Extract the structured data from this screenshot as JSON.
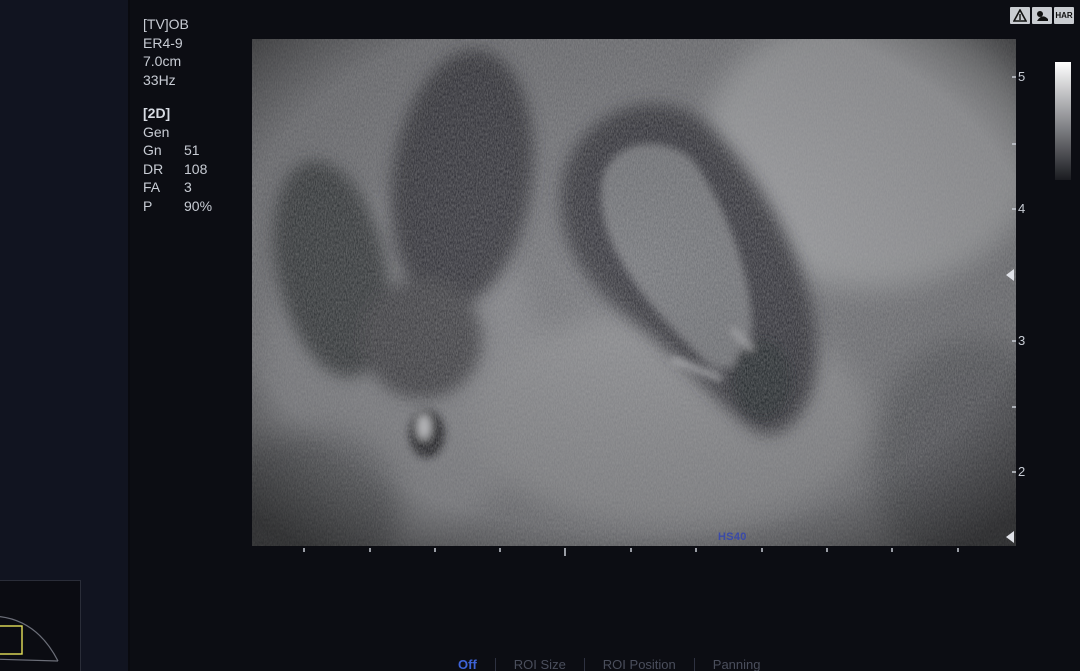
{
  "probe_info": {
    "preset": "[TV]OB",
    "probe": "ER4-9",
    "depth": "7.0cm",
    "frame_rate": "33Hz"
  },
  "mode_info": {
    "mode": "[2D]",
    "setting": "Gen",
    "params": [
      {
        "name": "Gn",
        "value": "51"
      },
      {
        "name": "DR",
        "value": "108"
      },
      {
        "name": "FA",
        "value": "3"
      },
      {
        "name": "P",
        "value": "90%"
      }
    ]
  },
  "depth_scale": {
    "labels": [
      "5",
      "4",
      "3",
      "2"
    ]
  },
  "image_overlay": {
    "harmonic_label": "HS40"
  },
  "top_icons": [
    {
      "name": "probe-orientation-icon",
      "label": "A"
    },
    {
      "name": "fetus-icon",
      "label": ""
    },
    {
      "name": "har-icon",
      "label": "HAR"
    }
  ],
  "bottom_menu": {
    "items": [
      "Off",
      "ROI Size",
      "ROI Position",
      "Panning"
    ],
    "active_index": 0
  },
  "colors": {
    "accent": "#3e63d8",
    "text": "#c8ccd4",
    "background": "#0c0d13"
  }
}
